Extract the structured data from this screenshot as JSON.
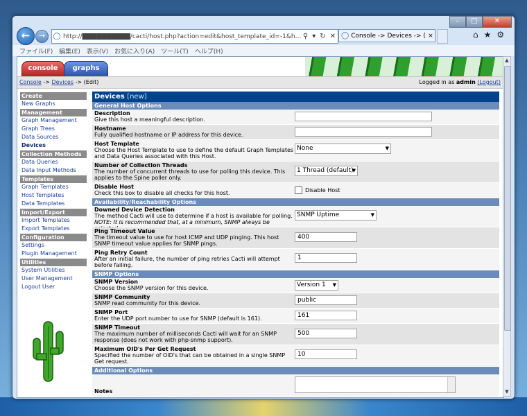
{
  "browser": {
    "url": "http://██████████/cacti/host.php?action=edit&host_template_id=-1&h…",
    "tab_title": "Console -> Devices -> (...",
    "menu": [
      "ファイル(F)",
      "編集(E)",
      "表示(V)",
      "お気に入り(A)",
      "ツール(T)",
      "ヘルプ(H)"
    ]
  },
  "cacti": {
    "tabs": {
      "console": "console",
      "graphs": "graphs"
    },
    "breadcrumb": {
      "console": "Console",
      "sep1": " -> ",
      "devices": "Devices",
      "sep2": " -> (Edit)"
    },
    "login": {
      "prefix": "Logged in as ",
      "user": "admin",
      "logout": "(Logout)"
    }
  },
  "nav": {
    "create": "Create",
    "new_graphs": "New Graphs",
    "management": "Management",
    "graph_management": "Graph Management",
    "graph_trees": "Graph Trees",
    "data_sources": "Data Sources",
    "devices": "Devices",
    "collection_methods": "Collection Methods",
    "data_queries": "Data Queries",
    "data_input_methods": "Data Input Methods",
    "templates": "Templates",
    "graph_templates": "Graph Templates",
    "host_templates": "Host Templates",
    "data_templates": "Data Templates",
    "import_export": "Import/Export",
    "import_templates": "Import Templates",
    "export_templates": "Export Templates",
    "configuration": "Configuration",
    "settings": "Settings",
    "plugin_management": "Plugin Management",
    "utilities": "Utilities",
    "system_utilities": "System Utilities",
    "user_management": "User Management",
    "logout_user": "Logout User"
  },
  "form": {
    "title": "Devices",
    "title_suffix": "[new]",
    "sections": {
      "general": "General Host Options",
      "availability": "Availability/Reachability Options",
      "snmp": "SNMP Options",
      "additional": "Additional Options"
    },
    "description": {
      "label": "Description",
      "help": "Give this host a meaningful description.",
      "value": ""
    },
    "hostname": {
      "label": "Hostname",
      "help": "Fully qualified hostname or IP address for this device.",
      "value": ""
    },
    "host_template": {
      "label": "Host Template",
      "help": "Choose the Host Template to use to define the default Graph Templates and Data Queries associated with this Host.",
      "value": "None"
    },
    "threads": {
      "label": "Number of Collection Threads",
      "help": "The number of concurrent threads to use for polling this device. This applies to the Spine poller only.",
      "value": "1 Thread (default)"
    },
    "disable_host": {
      "label": "Disable Host",
      "help": "Check this box to disable all checks for this host.",
      "checkbox_label": "Disable Host"
    },
    "downed_detection": {
      "label": "Downed Device Detection",
      "help": "The method Cacti will use to determine if a host is available for polling.",
      "note": "NOTE: It is recommended that, at a minimum, SNMP always be selected.",
      "value": "SNMP Uptime"
    },
    "ping_timeout": {
      "label": "Ping Timeout Value",
      "help": "The timeout value to use for host ICMP and UDP pinging. This host SNMP timeout value applies for SNMP pings.",
      "value": "400"
    },
    "ping_retry": {
      "label": "Ping Retry Count",
      "help": "After an initial failure, the number of ping retries Cacti will attempt before failing.",
      "value": "1"
    },
    "snmp_version": {
      "label": "SNMP Version",
      "help": "Choose the SNMP version for this device.",
      "value": "Version 1"
    },
    "snmp_community": {
      "label": "SNMP Community",
      "help": "SNMP read community for this device.",
      "value": "public"
    },
    "snmp_port": {
      "label": "SNMP Port",
      "help": "Enter the UDP port number to use for SNMP (default is 161).",
      "value": "161"
    },
    "snmp_timeout": {
      "label": "SNMP Timeout",
      "help": "The maximum number of milliseconds Cacti will wait for an SNMP response (does not work with php-snmp support).",
      "value": "500"
    },
    "max_oids": {
      "label": "Maximum OID's Per Get Request",
      "help": "Specified the number of OID's that can be obtained in a single SNMP Get request.",
      "value": "10"
    },
    "notes": {
      "label": "Notes",
      "value": ""
    }
  }
}
